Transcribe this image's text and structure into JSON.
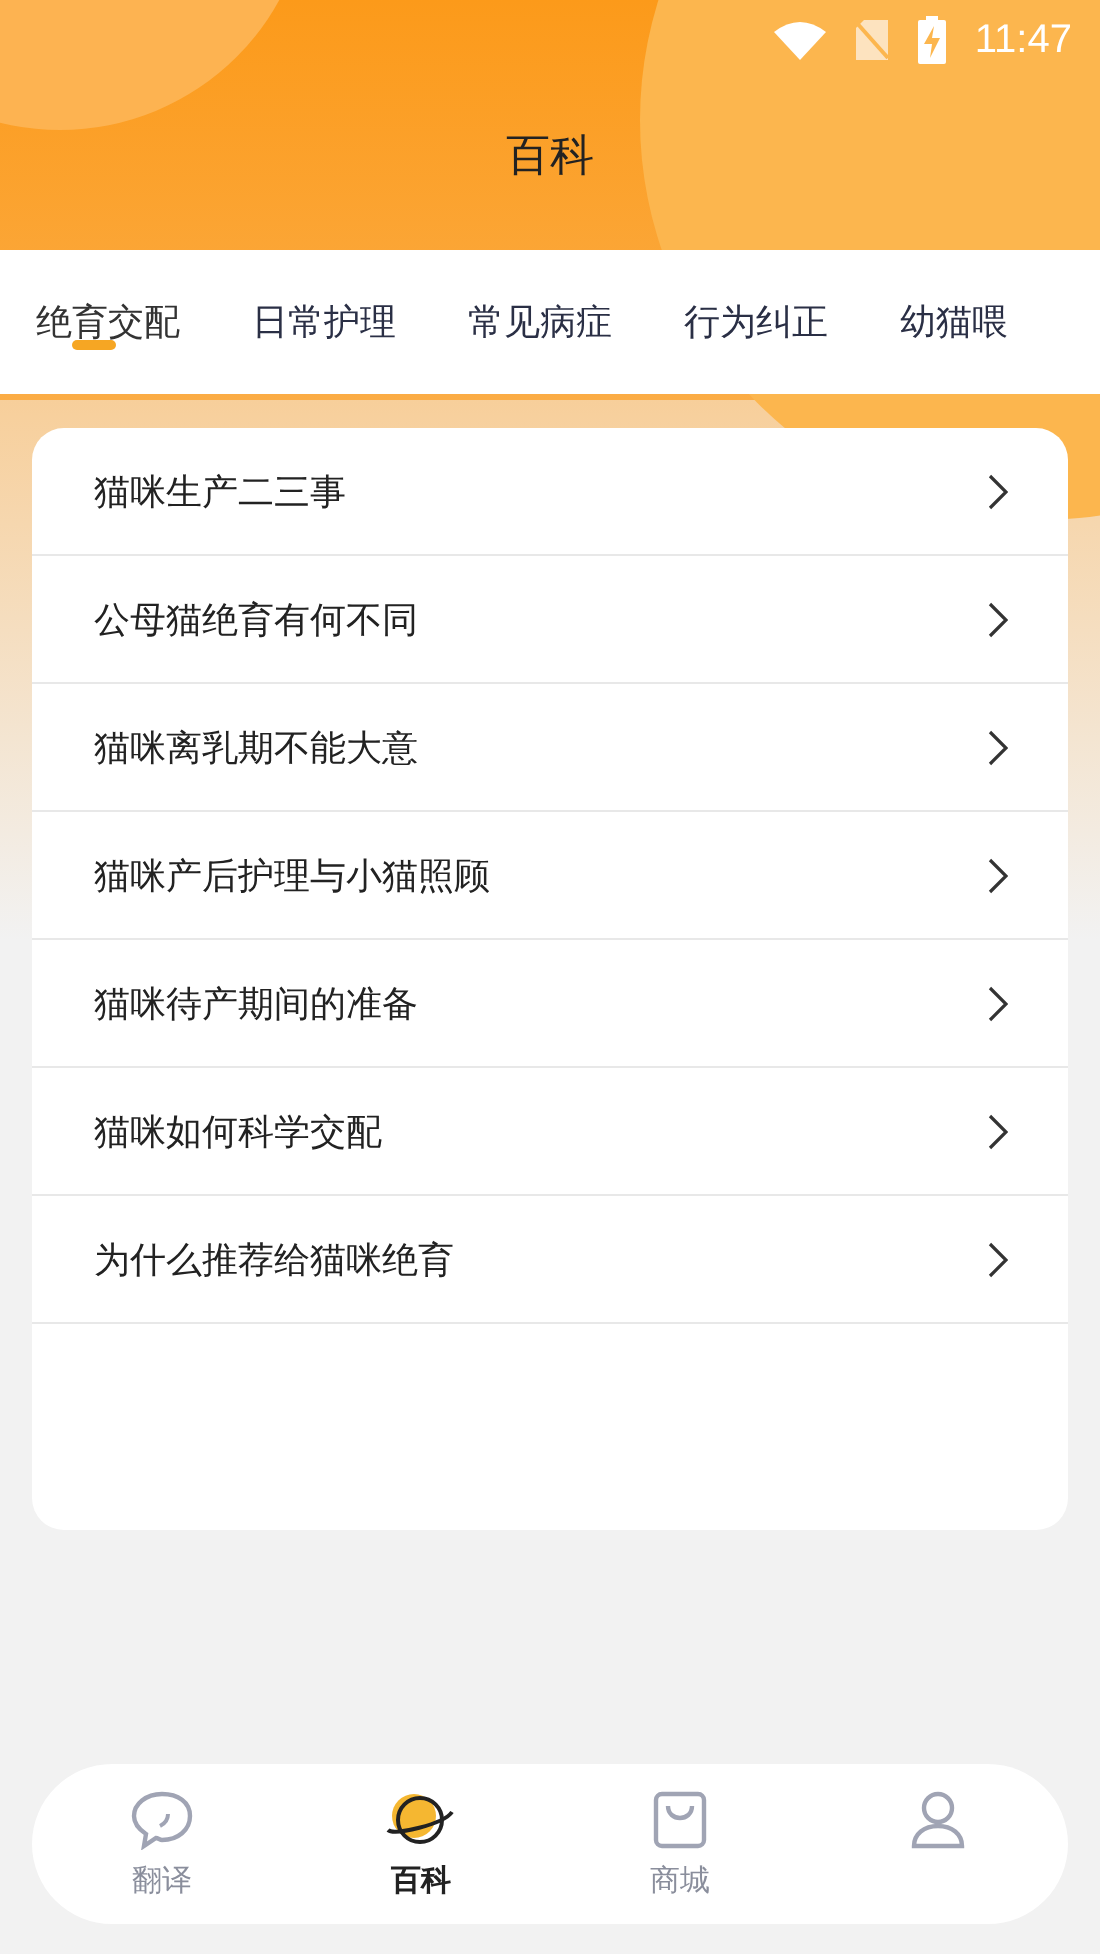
{
  "status_bar": {
    "time": "11:47"
  },
  "header": {
    "title": "百科"
  },
  "tabs": [
    {
      "label": "绝育交配",
      "selected": true
    },
    {
      "label": "日常护理",
      "selected": false
    },
    {
      "label": "常见病症",
      "selected": false
    },
    {
      "label": "行为纠正",
      "selected": false
    },
    {
      "label": "幼猫喂",
      "selected": false
    }
  ],
  "articles": [
    "猫咪生产二三事",
    "公母猫绝育有何不同",
    "猫咪离乳期不能大意",
    "猫咪产后护理与小猫照顾",
    "猫咪待产期间的准备",
    "猫咪如何科学交配",
    "为什么推荐给猫咪绝育"
  ],
  "bottom_nav": [
    {
      "kind": "chat",
      "label": "翻译",
      "selected": false
    },
    {
      "kind": "planet",
      "label": "百科",
      "selected": true
    },
    {
      "kind": "bag",
      "label": "商城",
      "selected": false
    },
    {
      "kind": "person",
      "selected": false
    }
  ]
}
